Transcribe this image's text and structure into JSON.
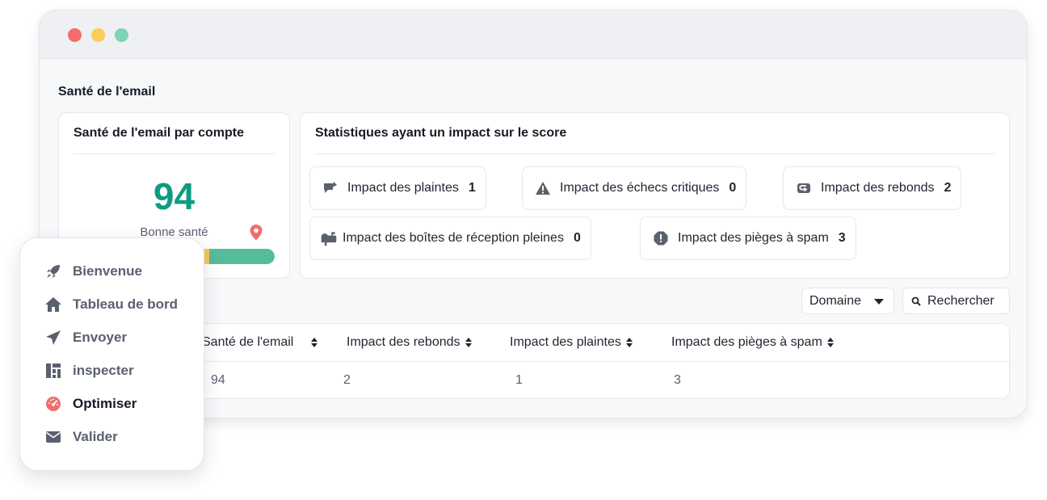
{
  "window": {
    "controls": [
      "close",
      "minimize",
      "maximize"
    ]
  },
  "page": {
    "title": "Santé de l'email"
  },
  "health_card": {
    "title": "Santé de l'email par compte",
    "score": "94",
    "status": "Bonne santé",
    "pin_icon": "location-pin-icon",
    "bar_color": "#57bc9b",
    "bar_accent": "#f8c55a"
  },
  "stats_card": {
    "title": "Statistiques ayant un impact sur le score",
    "items": [
      {
        "label": "Impact des plaintes",
        "value": "1",
        "icon": "complaint-icon"
      },
      {
        "label": "Impact des échecs critiques",
        "value": "0",
        "icon": "warning-icon"
      },
      {
        "label": "Impact des rebonds",
        "value": "2",
        "icon": "bounce-icon"
      },
      {
        "label": "Impact des boîtes de réception pleines",
        "value": "0",
        "icon": "mailbox-icon"
      },
      {
        "label": "Impact des pièges à spam",
        "value": "3",
        "icon": "spam-trap-icon"
      }
    ]
  },
  "filters": {
    "domain_select": "Domaine",
    "search_button": "Rechercher"
  },
  "table": {
    "columns": [
      "Santé de l'email",
      "Impact des rebonds",
      "Impact des plaintes",
      "Impact des pièges à spam"
    ],
    "rows": [
      [
        "94",
        "2",
        "1",
        "3"
      ]
    ]
  },
  "sidebar": {
    "items": [
      {
        "label": "Bienvenue",
        "icon": "rocket-icon",
        "active": false
      },
      {
        "label": "Tableau de bord",
        "icon": "home-icon",
        "active": false
      },
      {
        "label": "Envoyer",
        "icon": "send-icon",
        "active": false
      },
      {
        "label": "inspecter",
        "icon": "grid-icon",
        "active": false
      },
      {
        "label": "Optimiser",
        "icon": "gauge-icon",
        "active": true
      },
      {
        "label": "Valider",
        "icon": "envelope-icon",
        "active": false
      }
    ],
    "active_color": "#f26d6d"
  }
}
